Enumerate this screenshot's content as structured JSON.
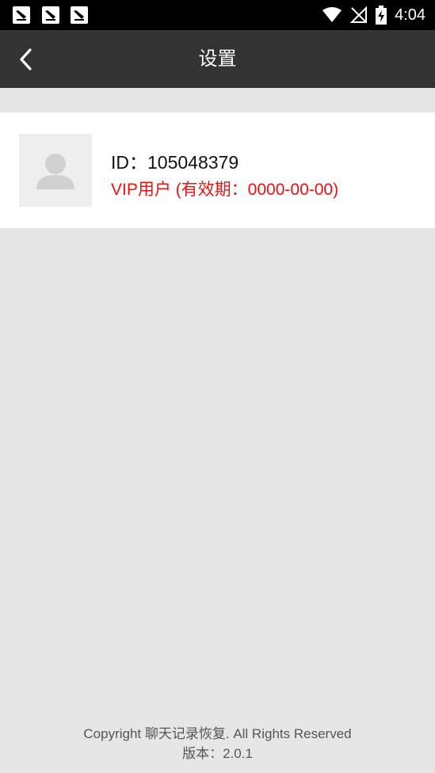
{
  "status_bar": {
    "time": "4:04",
    "notification_icons": [
      "notification-icon",
      "notification-icon",
      "notification-icon"
    ],
    "system_icons": [
      "wifi-icon",
      "no-signal-icon",
      "battery-charging-icon"
    ]
  },
  "app_bar": {
    "title": "设置",
    "back_icon": "back-arrow-icon"
  },
  "profile": {
    "id_text": "ID：105048379",
    "vip_text": "VIP用户 (有效期：0000-00-00)",
    "vip_color": "#ee1111",
    "avatar_icon": "user-avatar-icon"
  },
  "footer": {
    "copyright": "Copyright 聊天记录恢复. All Rights Reserved",
    "version": "版本：2.0.1"
  },
  "colors": {
    "status_bar": "#000000",
    "app_bar": "#333333",
    "background": "#e6e6e6",
    "card": "#ffffff"
  }
}
